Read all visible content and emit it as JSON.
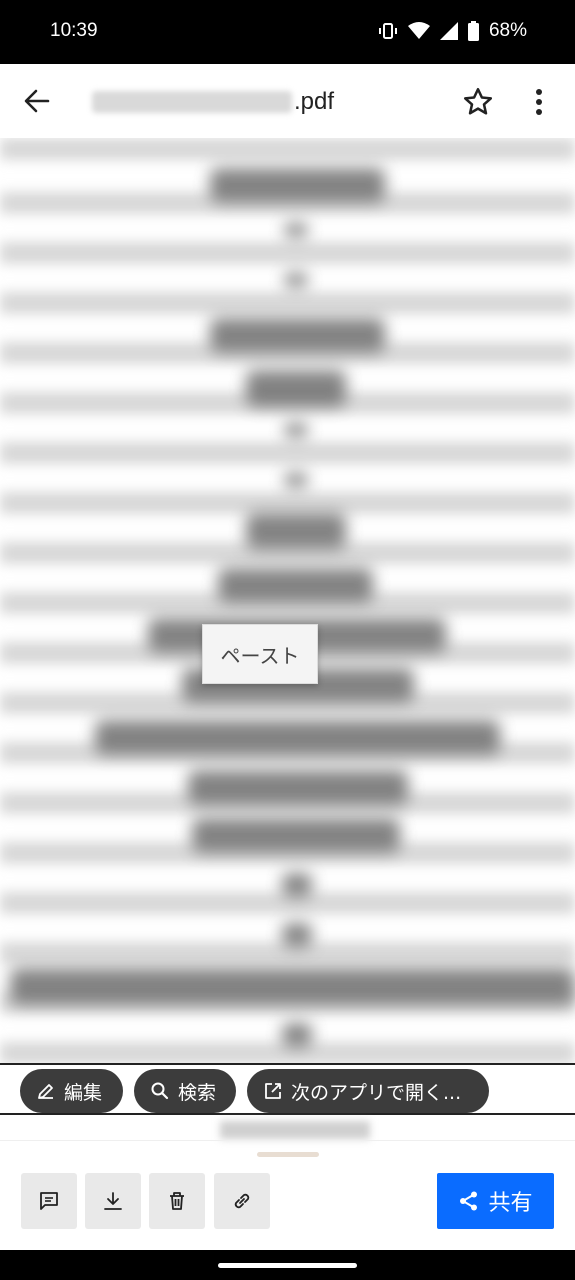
{
  "status_bar": {
    "time": "10:39",
    "battery": "68%",
    "icons": [
      "vibrate-icon",
      "wifi-icon",
      "signal-icon",
      "battery-icon"
    ]
  },
  "app_bar": {
    "back_icon": "arrow-left-icon",
    "file_extension": ".pdf",
    "star_icon": "star-outline-icon",
    "more_icon": "more-vert-icon"
  },
  "document": {
    "popup_label": "ペースト"
  },
  "actions": {
    "edit_label": "編集",
    "search_label": "検索",
    "open_with_label": "次のアプリで開く..."
  },
  "bottom_toolbar": {
    "tools": [
      "comment-icon",
      "download-icon",
      "delete-icon",
      "link-icon"
    ],
    "share_label": "共有",
    "share_color": "#0a6cff"
  }
}
